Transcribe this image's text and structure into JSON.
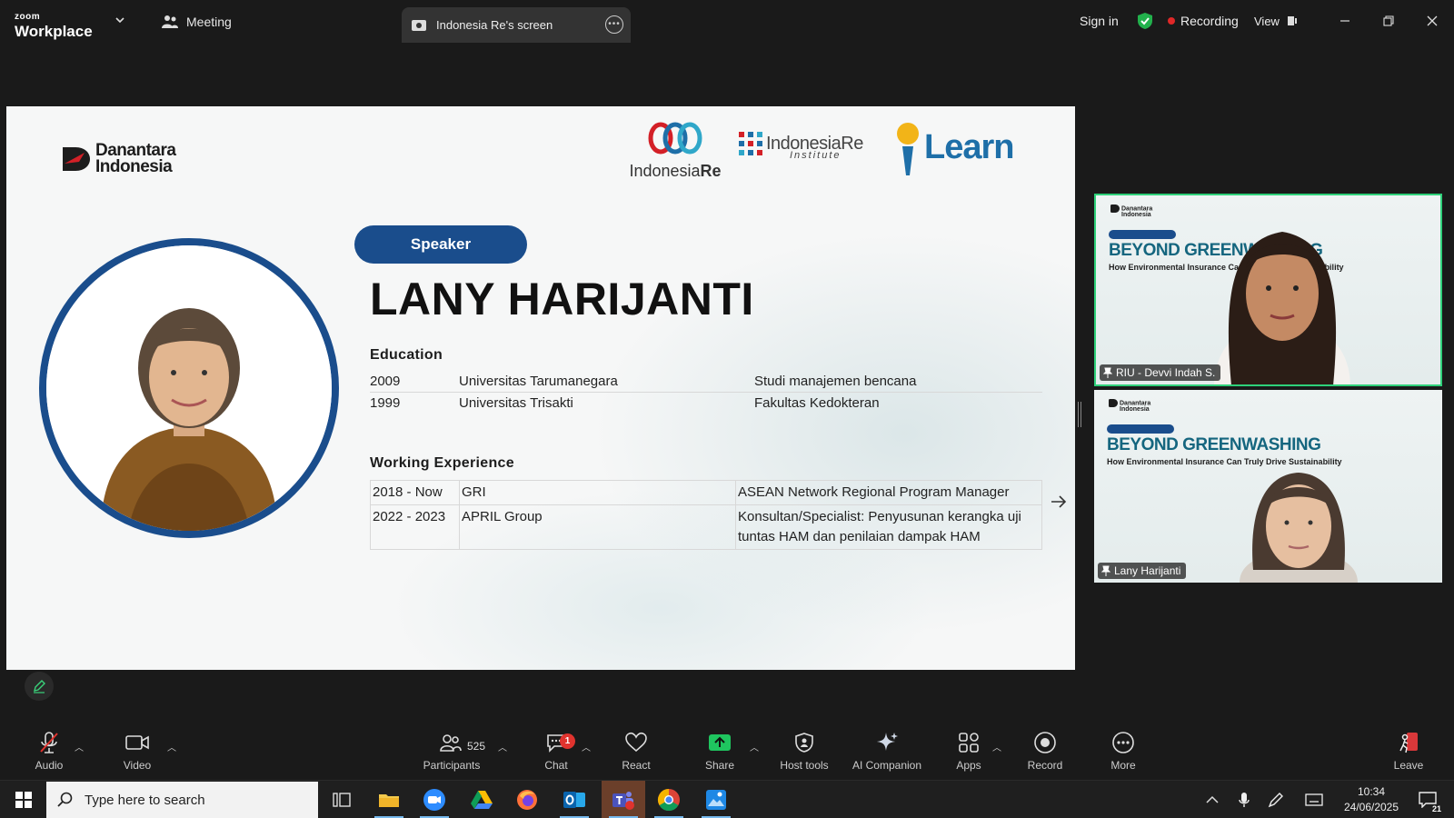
{
  "app": {
    "brand_top": "zoom",
    "brand_bottom": "Workplace"
  },
  "tabs": {
    "meeting": "Meeting",
    "screen": "Indonesia Re's screen"
  },
  "header": {
    "sign_in": "Sign in",
    "recording": "Recording",
    "view": "View"
  },
  "colors": {
    "brand_blue": "#1a4d8c",
    "active_speaker": "#2ed17a",
    "recording_red": "#e02828",
    "title_teal": "#15667f"
  },
  "slide": {
    "logos": {
      "danantara_line1": "Danantara",
      "danantara_line2": "Indonesia",
      "indonesia_re_a": "Indonesia",
      "indonesia_re_b": "Re",
      "institute_a": "Indonesia",
      "institute_b": "Re",
      "institute_sub": "Institute",
      "learn": "Learn"
    },
    "speaker_label": "Speaker",
    "speaker_name": "LANY HARIJANTI",
    "education_heading": "Education",
    "education": [
      {
        "year": "2009",
        "school": "Universitas Tarumanegara",
        "field": "Studi manajemen bencana"
      },
      {
        "year": "1999",
        "school": "Universitas Trisakti",
        "field": "Fakultas Kedokteran"
      }
    ],
    "work_heading": "Working Experience",
    "work": [
      {
        "period": "2018 - Now",
        "org": "GRI",
        "role": "ASEAN Network Regional Program Manager"
      },
      {
        "period": "2022 - 2023",
        "org": "APRIL Group",
        "role": "Konsultan/Specialist: Penyusunan kerangka uji tuntas HAM dan penilaian dampak HAM"
      }
    ]
  },
  "participants_tiles": [
    {
      "name": "RIU - Devvi Indah S.",
      "title": "BEYOND GREENWASHING",
      "subtitle": "How Environmental Insurance Can Truly Drive Sustainability"
    },
    {
      "name": "Lany Harijanti",
      "title": "BEYOND GREENWASHING",
      "subtitle": "How Environmental Insurance Can Truly Drive Sustainability"
    }
  ],
  "toolbar": {
    "audio": "Audio",
    "video": "Video",
    "participants": "Participants",
    "participant_count": "525",
    "chat": "Chat",
    "chat_badge": "1",
    "react": "React",
    "share": "Share",
    "host_tools": "Host tools",
    "ai_companion": "AI Companion",
    "apps": "Apps",
    "record": "Record",
    "more": "More",
    "leave": "Leave"
  },
  "taskbar": {
    "search_placeholder": "Type here to search",
    "time": "10:34",
    "date": "24/06/2025",
    "notification_count": "21"
  }
}
